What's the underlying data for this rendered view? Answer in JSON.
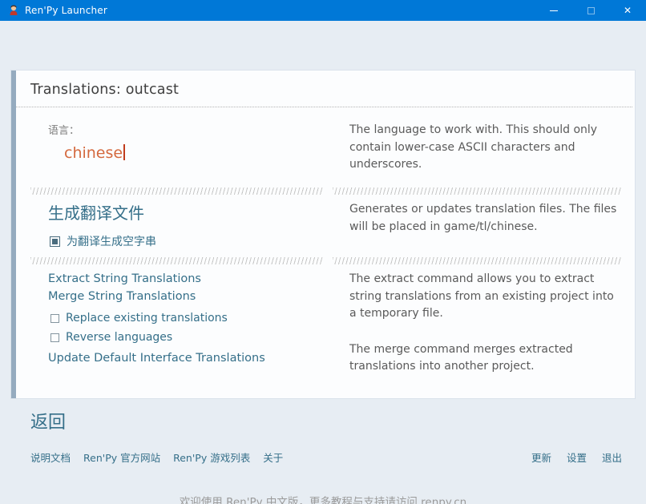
{
  "window": {
    "title": "Ren'Py Launcher",
    "controls": {
      "minimize": "minimize",
      "maximize": "maximize",
      "close": "✕"
    }
  },
  "page": {
    "title": "Translations: outcast"
  },
  "left": {
    "language_label": "语言：",
    "language_value": "chinese",
    "generate_heading": "生成翻译文件",
    "generate_checkbox": "为翻译生成空字串",
    "links": [
      "Extract String Translations",
      "Merge String Translations"
    ],
    "checkboxes": [
      "Replace existing translations",
      "Reverse languages"
    ],
    "update_link": "Update Default Interface Translations"
  },
  "right": {
    "p1": "The language to work with. This should only contain lower-case ASCII characters and underscores.",
    "p2": "Generates or updates translation files. The files will be placed in game/tl/chinese.",
    "p3": "The extract command allows you to extract string translations from an existing project into a temporary file.",
    "p4": "The merge command merges extracted translations into another project."
  },
  "footer": {
    "back": "返回",
    "left_links": [
      "说明文档",
      "Ren'Py 官方网站",
      "Ren'Py 游戏列表",
      "关于"
    ],
    "right_links": [
      "更新",
      "设置",
      "退出"
    ],
    "ticker": "欢迎使用 Ren'Py 中文版，更多教程与支持请访问 renpy.cn"
  },
  "colors": {
    "titlebar": "#0078d7",
    "accent_orange": "#d4693e",
    "link_teal": "#356f89",
    "stripe": "#95abbf"
  }
}
